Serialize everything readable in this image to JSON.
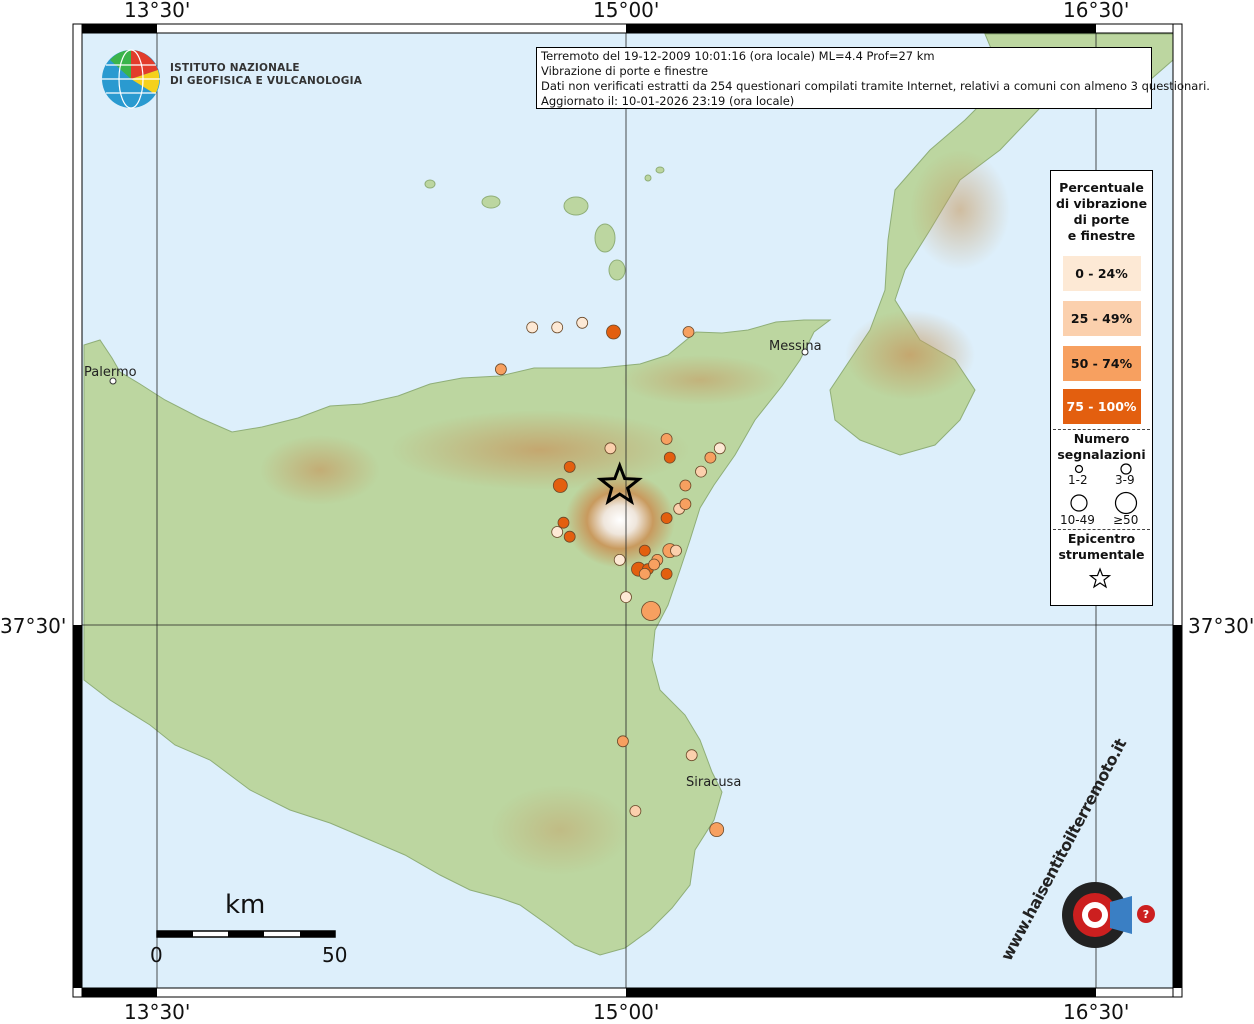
{
  "coords": {
    "top_lon": [
      "13°30'",
      "15°00'",
      "16°30'"
    ],
    "bottom_lon": [
      "13°30'",
      "15°00'",
      "16°30'"
    ],
    "lat_left": "37°30'",
    "lat_right": "37°30'"
  },
  "info": {
    "line1": "Terremoto del 19-12-2009 10:01:16 (ora locale) ML=4.4 Prof=27 km",
    "line2": "Vibrazione di porte e finestre",
    "line3": "Dati non verificati estratti da 254 questionari compilati tramite Internet, relativi a comuni con almeno 3 questionari.",
    "line4": "Aggiornato il: 10-01-2026 23:19 (ora locale)"
  },
  "ingv": {
    "line1": "ISTITUTO NAZIONALE",
    "line2": "DI GEOFISICA E VULCANOLOGIA"
  },
  "legend": {
    "title_lines": [
      "Percentuale",
      "di vibrazione",
      "di porte",
      "e finestre"
    ],
    "classes": [
      {
        "label": "0 - 24%",
        "color": "#fde9d5"
      },
      {
        "label": "25 - 49%",
        "color": "#fbd0ad"
      },
      {
        "label": "50 - 74%",
        "color": "#f7a060"
      },
      {
        "label": "75 - 100%",
        "color": "#e35f0f"
      }
    ],
    "count_title_lines": [
      "Numero",
      "segnalazioni"
    ],
    "count_labels": [
      "1-2",
      "3-9",
      "10-49",
      "≥50"
    ],
    "epicenter_title_lines": [
      "Epicentro",
      "strumentale"
    ],
    "epicenter_icon": "star-icon"
  },
  "places": [
    "Palermo",
    "Messina",
    "Siracusa"
  ],
  "scale": {
    "title": "km",
    "min": "0",
    "max": "50"
  },
  "logo_hsnt": {
    "text": "www.haisentitoilterremoto.it",
    "icon": "megaphone-icon"
  },
  "colors": {
    "sea": "#ddeffb",
    "land": "#bcd6a0",
    "accent": "#e35f0f"
  },
  "observations": [
    {
      "lon": 14.7,
      "lat": 38.14,
      "pct": "0-24",
      "n": "1-2"
    },
    {
      "lon": 14.78,
      "lat": 38.14,
      "pct": "0-24",
      "n": "1-2"
    },
    {
      "lon": 14.96,
      "lat": 38.13,
      "pct": "75-100",
      "n": "3-9"
    },
    {
      "lon": 15.2,
      "lat": 38.13,
      "pct": "50-74",
      "n": "1-2"
    },
    {
      "lon": 14.86,
      "lat": 38.15,
      "pct": "0-24",
      "n": "1-2"
    },
    {
      "lon": 14.6,
      "lat": 38.05,
      "pct": "50-74",
      "n": "1-2"
    },
    {
      "lon": 15.13,
      "lat": 37.9,
      "pct": "50-74",
      "n": "1-2"
    },
    {
      "lon": 14.95,
      "lat": 37.88,
      "pct": "25-49",
      "n": "1-2"
    },
    {
      "lon": 15.27,
      "lat": 37.86,
      "pct": "50-74",
      "n": "1-2"
    },
    {
      "lon": 15.3,
      "lat": 37.88,
      "pct": "0-24",
      "n": "1-2"
    },
    {
      "lon": 15.24,
      "lat": 37.83,
      "pct": "25-49",
      "n": "1-2"
    },
    {
      "lon": 15.14,
      "lat": 37.86,
      "pct": "75-100",
      "n": "1-2"
    },
    {
      "lon": 14.82,
      "lat": 37.84,
      "pct": "75-100",
      "n": "1-2"
    },
    {
      "lon": 14.79,
      "lat": 37.8,
      "pct": "75-100",
      "n": "3-9"
    },
    {
      "lon": 15.19,
      "lat": 37.8,
      "pct": "50-74",
      "n": "1-2"
    },
    {
      "lon": 15.17,
      "lat": 37.75,
      "pct": "25-49",
      "n": "1-2"
    },
    {
      "lon": 15.19,
      "lat": 37.76,
      "pct": "50-74",
      "n": "1-2"
    },
    {
      "lon": 15.13,
      "lat": 37.73,
      "pct": "75-100",
      "n": "1-2"
    },
    {
      "lon": 14.8,
      "lat": 37.72,
      "pct": "75-100",
      "n": "1-2"
    },
    {
      "lon": 14.82,
      "lat": 37.69,
      "pct": "75-100",
      "n": "1-2"
    },
    {
      "lon": 14.78,
      "lat": 37.7,
      "pct": "0-24",
      "n": "1-2"
    },
    {
      "lon": 15.06,
      "lat": 37.66,
      "pct": "75-100",
      "n": "1-2"
    },
    {
      "lon": 15.14,
      "lat": 37.66,
      "pct": "50-74",
      "n": "3-9"
    },
    {
      "lon": 15.16,
      "lat": 37.66,
      "pct": "25-49",
      "n": "1-2"
    },
    {
      "lon": 15.1,
      "lat": 37.64,
      "pct": "50-74",
      "n": "1-2"
    },
    {
      "lon": 15.04,
      "lat": 37.62,
      "pct": "75-100",
      "n": "3-9"
    },
    {
      "lon": 15.07,
      "lat": 37.62,
      "pct": "75-100",
      "n": "1-2"
    },
    {
      "lon": 15.09,
      "lat": 37.63,
      "pct": "50-74",
      "n": "1-2"
    },
    {
      "lon": 15.06,
      "lat": 37.61,
      "pct": "50-74",
      "n": "1-2"
    },
    {
      "lon": 15.13,
      "lat": 37.61,
      "pct": "75-100",
      "n": "1-2"
    },
    {
      "lon": 14.98,
      "lat": 37.64,
      "pct": "0-24",
      "n": "1-2"
    },
    {
      "lon": 15.0,
      "lat": 37.56,
      "pct": "0-24",
      "n": "1-2"
    },
    {
      "lon": 15.08,
      "lat": 37.53,
      "pct": "50-74",
      "n": "10-49"
    },
    {
      "lon": 14.99,
      "lat": 37.25,
      "pct": "50-74",
      "n": "1-2"
    },
    {
      "lon": 15.21,
      "lat": 37.22,
      "pct": "25-49",
      "n": "1-2"
    },
    {
      "lon": 15.03,
      "lat": 37.1,
      "pct": "25-49",
      "n": "1-2"
    },
    {
      "lon": 15.29,
      "lat": 37.06,
      "pct": "50-74",
      "n": "3-9"
    }
  ],
  "epicenter": {
    "lon": 14.98,
    "lat": 37.8
  }
}
